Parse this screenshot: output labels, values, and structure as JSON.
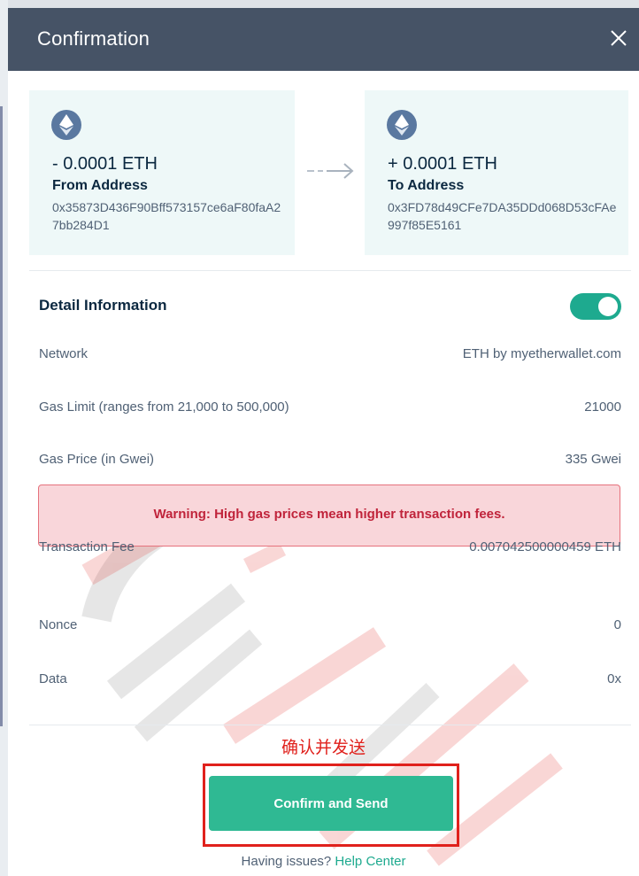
{
  "header": {
    "title": "Confirmation"
  },
  "from": {
    "amount": "- 0.0001 ETH",
    "label": "From Address",
    "address": "0x35873D436F90Bff573157ce6aF80faA27bb284D1"
  },
  "to": {
    "amount": "+ 0.0001 ETH",
    "label": "To Address",
    "address": "0x3FD78d49CFe7DA35DDd068D53cFAe997f85E5161"
  },
  "details": {
    "title": "Detail Information",
    "toggle_on": true,
    "network": {
      "label": "Network",
      "value": "ETH by myetherwallet.com"
    },
    "gas_limit": {
      "label": "Gas Limit (ranges from 21,000 to 500,000)",
      "value": "21000"
    },
    "gas_price": {
      "label": "Gas Price (in Gwei)",
      "value": "335 Gwei"
    },
    "warning": "Warning: High gas prices mean higher transaction fees.",
    "tx_fee": {
      "label": "Transaction Fee",
      "value": "0.007042500000459 ETH"
    },
    "nonce": {
      "label": "Nonce",
      "value": "0"
    },
    "data": {
      "label": "Data",
      "value": "0x"
    }
  },
  "annotation": {
    "cn_label": "确认并发送"
  },
  "footer": {
    "confirm_label": "Confirm and Send",
    "help_prefix": "Having issues?",
    "help_link": "Help Center"
  },
  "colors": {
    "header_bg": "#465366",
    "accent": "#1eaa8f",
    "button": "#2fb993",
    "warning_bg": "#f9d6da",
    "warning_text": "#c0243b",
    "annotation_red": "#e0211c"
  },
  "icons": [
    "close-icon",
    "eth-icon",
    "arrow-right-icon"
  ]
}
